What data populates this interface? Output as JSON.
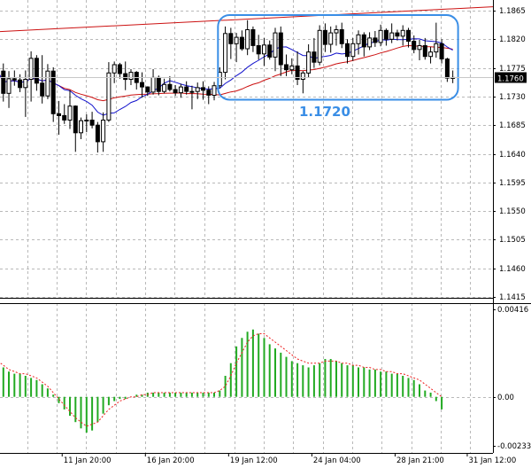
{
  "chart_data": [
    {
      "type": "candlestick",
      "panel": "price",
      "symbol": "",
      "ylim": [
        1.14,
        1.188
      ],
      "price_ticks": [
        "1.1865",
        "1.1820",
        "1.1775",
        "1.1730",
        "1.1685",
        "1.1640",
        "1.1595",
        "1.1550",
        "1.1505",
        "1.1460",
        "1.1415"
      ],
      "current_price": "1.1760",
      "annotation": "1.1720",
      "candles_ohlc": [
        [
          1.1762,
          1.1788,
          1.1742,
          1.177
        ],
        [
          1.177,
          1.1782,
          1.1722,
          1.1735
        ],
        [
          1.1735,
          1.177,
          1.1712,
          1.1758
        ],
        [
          1.1758,
          1.1771,
          1.1747,
          1.1756
        ],
        [
          1.1756,
          1.1765,
          1.1737,
          1.1744
        ],
        [
          1.1744,
          1.1771,
          1.1698,
          1.1757
        ],
        [
          1.1757,
          1.1801,
          1.1722,
          1.179
        ],
        [
          1.179,
          1.1795,
          1.1739,
          1.1751
        ],
        [
          1.1751,
          1.1795,
          1.1719,
          1.1731
        ],
        [
          1.1731,
          1.1781,
          1.1726,
          1.177
        ],
        [
          1.177,
          1.1776,
          1.169,
          1.1703
        ],
        [
          1.1703,
          1.1723,
          1.167,
          1.17
        ],
        [
          1.17,
          1.1718,
          1.1687,
          1.1693
        ],
        [
          1.1693,
          1.174,
          1.1679,
          1.1715
        ],
        [
          1.1715,
          1.1716,
          1.1643,
          1.1673
        ],
        [
          1.1673,
          1.1697,
          1.1663,
          1.1692
        ],
        [
          1.1692,
          1.1702,
          1.1674,
          1.1693
        ],
        [
          1.1693,
          1.1706,
          1.168,
          1.1685
        ],
        [
          1.1685,
          1.169,
          1.1642,
          1.1659
        ],
        [
          1.1659,
          1.1705,
          1.1643,
          1.1693
        ],
        [
          1.1693,
          1.1784,
          1.169,
          1.1767
        ],
        [
          1.1767,
          1.1785,
          1.1751,
          1.178
        ],
        [
          1.178,
          1.1783,
          1.1758,
          1.1766
        ],
        [
          1.1766,
          1.1785,
          1.174,
          1.1757
        ],
        [
          1.1757,
          1.1773,
          1.1748,
          1.1768
        ],
        [
          1.1768,
          1.177,
          1.1741,
          1.1752
        ],
        [
          1.1752,
          1.1768,
          1.1728,
          1.1745
        ],
        [
          1.1745,
          1.1746,
          1.1731,
          1.1737
        ],
        [
          1.1737,
          1.1773,
          1.1733,
          1.176
        ],
        [
          1.176,
          1.1763,
          1.1732,
          1.1738
        ],
        [
          1.1738,
          1.1758,
          1.1735,
          1.1749
        ],
        [
          1.1749,
          1.1762,
          1.1738,
          1.1741
        ],
        [
          1.1741,
          1.1748,
          1.1731,
          1.1736
        ],
        [
          1.1736,
          1.175,
          1.1728,
          1.1745
        ],
        [
          1.1745,
          1.1754,
          1.1733,
          1.1738
        ],
        [
          1.1738,
          1.1747,
          1.171,
          1.1738
        ],
        [
          1.1738,
          1.1752,
          1.1726,
          1.1744
        ],
        [
          1.1744,
          1.1754,
          1.1725,
          1.174
        ],
        [
          1.174,
          1.1746,
          1.1718,
          1.1732
        ],
        [
          1.1732,
          1.1753,
          1.1724,
          1.1747
        ],
        [
          1.1747,
          1.1776,
          1.1743,
          1.1768
        ],
        [
          1.1768,
          1.184,
          1.1757,
          1.1829
        ],
        [
          1.1829,
          1.1838,
          1.1789,
          1.1813
        ],
        [
          1.1813,
          1.183,
          1.1784,
          1.1823
        ],
        [
          1.1823,
          1.1834,
          1.1802,
          1.1805
        ],
        [
          1.1805,
          1.185,
          1.1795,
          1.1835
        ],
        [
          1.1835,
          1.184,
          1.18,
          1.181
        ],
        [
          1.181,
          1.1827,
          1.1788,
          1.1797
        ],
        [
          1.1797,
          1.1822,
          1.1778,
          1.1811
        ],
        [
          1.1811,
          1.1818,
          1.1788,
          1.1792
        ],
        [
          1.1792,
          1.1838,
          1.177,
          1.183
        ],
        [
          1.183,
          1.184,
          1.1762,
          1.178
        ],
        [
          1.178,
          1.1796,
          1.1762,
          1.1772
        ],
        [
          1.1772,
          1.179,
          1.1765,
          1.1778
        ],
        [
          1.1778,
          1.1801,
          1.1748,
          1.1757
        ],
        [
          1.1757,
          1.177,
          1.1735,
          1.1767
        ],
        [
          1.1767,
          1.1812,
          1.176,
          1.18
        ],
        [
          1.18,
          1.1822,
          1.1775,
          1.1784
        ],
        [
          1.1784,
          1.1842,
          1.1779,
          1.1834
        ],
        [
          1.1834,
          1.1845,
          1.18,
          1.1812
        ],
        [
          1.1812,
          1.184,
          1.1799,
          1.183
        ],
        [
          1.183,
          1.1842,
          1.181,
          1.1835
        ],
        [
          1.1835,
          1.1846,
          1.1806,
          1.1813
        ],
        [
          1.1813,
          1.182,
          1.1782,
          1.1793
        ],
        [
          1.1793,
          1.1822,
          1.1786,
          1.1813
        ],
        [
          1.1813,
          1.1834,
          1.1796,
          1.1827
        ],
        [
          1.1827,
          1.1831,
          1.1793,
          1.1808
        ],
        [
          1.1808,
          1.1831,
          1.1803,
          1.1822
        ],
        [
          1.1822,
          1.1833,
          1.1808,
          1.1815
        ],
        [
          1.1815,
          1.1843,
          1.1809,
          1.1834
        ],
        [
          1.1834,
          1.1837,
          1.181,
          1.182
        ],
        [
          1.182,
          1.1845,
          1.1814,
          1.183
        ],
        [
          1.183,
          1.1835,
          1.1818,
          1.1825
        ],
        [
          1.1825,
          1.1842,
          1.181,
          1.1834
        ],
        [
          1.1834,
          1.1838,
          1.1807,
          1.1817
        ],
        [
          1.1817,
          1.1826,
          1.1798,
          1.1804
        ],
        [
          1.1804,
          1.1819,
          1.1787,
          1.181
        ],
        [
          1.181,
          1.1822,
          1.1788,
          1.1793
        ],
        [
          1.1793,
          1.1808,
          1.1782,
          1.18
        ],
        [
          1.18,
          1.1846,
          1.1791,
          1.1813
        ],
        [
          1.1813,
          1.182,
          1.1782,
          1.1789
        ],
        [
          1.1789,
          1.1791,
          1.1753,
          1.1759
        ],
        [
          1.1759,
          1.1771,
          1.1751,
          1.176
        ]
      ],
      "overlays": [
        {
          "kind": "moving-average",
          "color": "#1111cc"
        },
        {
          "kind": "moving-average",
          "color": "#cc1111"
        },
        {
          "kind": "trendline",
          "color": "#cc1111",
          "from": [
            0,
            1.1832
          ],
          "to": [
            82,
            1.1868
          ]
        },
        {
          "kind": "rounded-box",
          "color": "#3a8ee6",
          "x_range": [
            40,
            82
          ],
          "y_range": [
            1.1725,
            1.1858
          ]
        }
      ],
      "grid": true
    },
    {
      "type": "bar",
      "panel": "oscillator",
      "ylim": [
        -0.00233,
        0.00416
      ],
      "y_ticks": [
        "0.00416",
        "0.00",
        "-0.00233"
      ],
      "x_tick_labels": [
        "11 Jan 20:00",
        "16 Jan 20:00",
        "19 Jan 12:00",
        "24 Jan 04:00",
        "28 Jan 21:00",
        "31 Jan 12:00"
      ],
      "x_tick_positions": [
        12,
        27,
        42,
        57,
        72,
        85
      ],
      "values": [
        0.0017,
        0.0014,
        0.0012,
        0.0011,
        0.0011,
        0.001,
        0.0009,
        0.0008,
        0.0006,
        0.0004,
        0.0001,
        -0.0003,
        -0.0006,
        -0.0009,
        -0.0012,
        -0.0015,
        -0.0017,
        -0.0016,
        -0.0012,
        -0.0008,
        -0.0004,
        -0.0002,
        -0.0001,
        -0.0001,
        0.0,
        0.0001,
        0.0001,
        0.0002,
        0.0002,
        0.0002,
        0.0002,
        0.0002,
        0.0002,
        0.0002,
        0.0002,
        0.0002,
        0.0002,
        0.0002,
        0.0002,
        0.0002,
        0.0003,
        0.001,
        0.0016,
        0.0024,
        0.0028,
        0.0031,
        0.0032,
        0.003,
        0.0028,
        0.0025,
        0.0023,
        0.0021,
        0.0019,
        0.0017,
        0.0016,
        0.0015,
        0.0014,
        0.0015,
        0.0016,
        0.0018,
        0.0018,
        0.0017,
        0.0016,
        0.0015,
        0.0015,
        0.0014,
        0.0014,
        0.0013,
        0.0013,
        0.0012,
        0.0012,
        0.0011,
        0.0011,
        0.001,
        0.0009,
        0.0008,
        0.0006,
        0.0003,
        0.0002,
        -0.0002,
        -0.0006
      ],
      "signal": [
        0.0017,
        0.0015,
        0.0013,
        0.0012,
        0.0011,
        0.0011,
        0.001,
        0.0009,
        0.0007,
        0.0005,
        0.0002,
        -0.0001,
        -0.0004,
        -0.0007,
        -0.001,
        -0.0012,
        -0.0014,
        -0.0013,
        -0.0012,
        -0.0009,
        -0.0006,
        -0.0004,
        -0.0002,
        -0.0001,
        0.0,
        0.0,
        0.0001,
        0.0001,
        0.0002,
        0.0002,
        0.0002,
        0.0002,
        0.0002,
        0.0002,
        0.0002,
        0.0002,
        0.0002,
        0.0002,
        0.0002,
        0.0002,
        0.0003,
        0.0005,
        0.001,
        0.0016,
        0.0021,
        0.0026,
        0.0029,
        0.003,
        0.003,
        0.0028,
        0.0026,
        0.0024,
        0.0022,
        0.002,
        0.0018,
        0.0017,
        0.0016,
        0.0016,
        0.0016,
        0.0017,
        0.0017,
        0.0017,
        0.0016,
        0.0016,
        0.0015,
        0.0015,
        0.0014,
        0.0014,
        0.0013,
        0.0013,
        0.0012,
        0.0012,
        0.0011,
        0.0011,
        0.001,
        0.0009,
        0.0008,
        0.0006,
        0.0004,
        0.0002,
        0.0
      ],
      "bar_color": "#22aa22",
      "signal_color": "#ee2222",
      "grid": true
    }
  ],
  "colors": {
    "background": "#ffffff",
    "grid": "#b9b9b9",
    "candle": "#000000",
    "axis_text": "#000000",
    "current_price_bg": "#000000",
    "current_price_text": "#ffffff"
  }
}
